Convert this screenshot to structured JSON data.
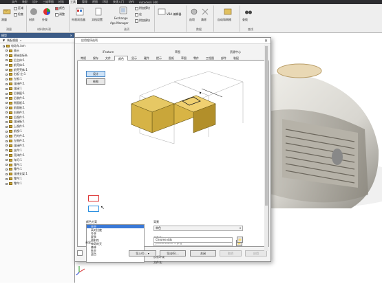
{
  "menu": {
    "items": [
      "文件",
      "装配",
      "设计",
      "三维草图",
      "检验",
      "工具",
      "管理",
      "视图",
      "环境",
      "快速入门",
      "协作"
    ],
    "active": "工具",
    "title": "Autodesk 360"
  },
  "ribbon": {
    "buttons": {
      "measure": "测量",
      "region_prop": "区域",
      "check": "检查",
      "material": "材质",
      "appearance": "外观",
      "color": "颜色",
      "adjust": "调整",
      "appearance_browser": "外观浏览器",
      "doc_settings": "文档设置",
      "exchange": "Exchange",
      "app_manager": "App Manager",
      "addins": "附加模块",
      "macros": "宏",
      "vba_editor": "VBA 编辑器",
      "options": "选项",
      "manage_db": "数据库",
      "search": "搜索",
      "clear": "清除",
      "autoweb": "自动和网格",
      "find": "查找"
    },
    "groups": {
      "measure": "测量",
      "material_appearance": "材料和外观",
      "options": "选项",
      "data": "数据",
      "find": "查找"
    }
  },
  "browser": {
    "title": "模型",
    "filter_label": "装配视图",
    "items": [
      "电动车.iam",
      "表示",
      "原始坐标系",
      "后主体:1",
      "前壳体:1",
      "前壳壳体:1",
      "右板-左:1",
      "左板:1",
      "连接件:1",
      "连接:1",
      "后装配:1",
      "后装件:1",
      "侧面板:1",
      "前面板:1",
      "右侧件:1",
      "后视件:1",
      "连接板:1",
      "上视件:1",
      "前视:1",
      "另外件:1",
      "左侧件:1",
      "连接件:1",
      "支件:1",
      "壳体件:1",
      "车灯:1",
      "零件:1",
      "零件:1",
      "连接支架:1",
      "零件:1",
      "零件:1"
    ]
  },
  "dialog": {
    "title": "应用程序选项",
    "tabs_top": {
      "ifeature": "iFeature",
      "sketch": "草图",
      "content_center": "资源中心"
    },
    "tabs": [
      "常规",
      "保存",
      "文件",
      "颜色",
      "显示",
      "硬件",
      "提示",
      "图纸",
      "草图",
      "零件",
      "工程图",
      "部件",
      "装配"
    ],
    "active_tab": "颜色",
    "design_btn": "设计",
    "draw_btn": "绘图",
    "color_scheme_label": "颜色方案",
    "color_schemes": [
      "天空",
      "高对比度",
      "冬季",
      "夏季",
      "放射性",
      "神奇的天",
      "森林",
      "秋天",
      "蓝色"
    ],
    "selected_scheme": "天空",
    "background_label": "背景",
    "background_value": "单色",
    "file_name_label": "文件名:",
    "bg_file": "presentation-1.png",
    "reflection_label": "反射环境",
    "reflection_file_label": "文件名:",
    "reflection_file": "Chrome.dds",
    "highlight_label": "亮显",
    "import_btn": "导入(I)...",
    "export_btn": "导出(E)...",
    "close_btn": "关闭",
    "cancel_btn": "取消",
    "apply_btn": "应用"
  }
}
